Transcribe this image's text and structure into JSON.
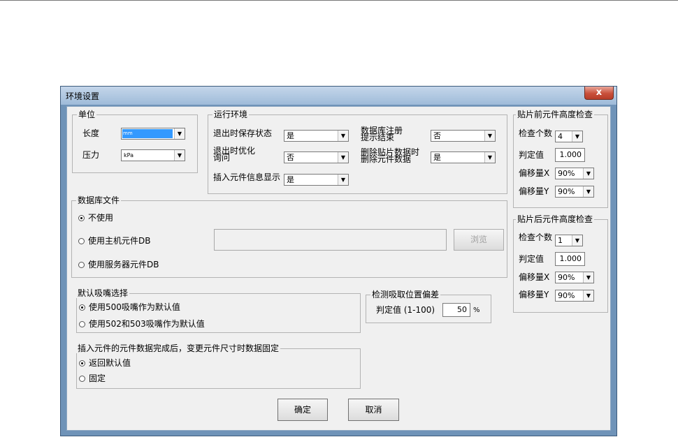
{
  "dialog": {
    "title": "环境设置",
    "close_label": "x"
  },
  "unit": {
    "legend": "单位",
    "length_label": "长度",
    "length_value": "mm",
    "pressure_label": "压力",
    "pressure_value": "kPa"
  },
  "runtime": {
    "legend": "运行环境",
    "save_on_exit_label": "退出时保存状态",
    "save_on_exit_value": "是",
    "optimize_line1": "退出时优化",
    "optimize_line2": "询问",
    "optimize_value": "否",
    "insert_info_label": "插入元件信息显示",
    "insert_info_value": "是",
    "db_register_line1": "数据库注册",
    "db_register_line2": "提示结束",
    "db_register_value": "否",
    "delete_data_line1": "删除贴片数据时",
    "delete_data_line2": "删除元件数据",
    "delete_data_value": "是"
  },
  "pre_check": {
    "legend": "贴片前元件高度检查",
    "count_label": "检查个数",
    "count_value": "4",
    "judge_label": "判定值",
    "judge_value": "1.000",
    "offset_x_label": "偏移量X",
    "offset_x_value": "90%",
    "offset_y_label": "偏移量Y",
    "offset_y_value": "90%"
  },
  "post_check": {
    "legend": "贴片后元件高度检查",
    "count_label": "检查个数",
    "count_value": "1",
    "judge_label": "判定值",
    "judge_value": "1.000",
    "offset_x_label": "偏移量X",
    "offset_x_value": "90%",
    "offset_y_label": "偏移量Y",
    "offset_y_value": "90%"
  },
  "database": {
    "legend": "数据库文件",
    "opt_none": "不使用",
    "opt_host": "使用主机元件DB",
    "opt_server": "使用服务器元件DB",
    "browse_label": "浏览",
    "selected": "none"
  },
  "nozzle": {
    "legend": "默认吸嘴选择",
    "opt_500": "使用500吸嘴作为默认值",
    "opt_502": "使用502和503吸嘴作为默认值",
    "selected": "500"
  },
  "pickup": {
    "legend": "检测吸取位置偏差",
    "judge_label": "判定值 (1-100)",
    "judge_value": "50",
    "unit": "%"
  },
  "insert": {
    "legend": "插入元件的元件数据完成后，变更元件尺寸时数据固定",
    "opt_return": "返回默认值",
    "opt_fixed": "固定",
    "selected": "return"
  },
  "footer": {
    "ok_label": "确定",
    "cancel_label": "取消"
  }
}
